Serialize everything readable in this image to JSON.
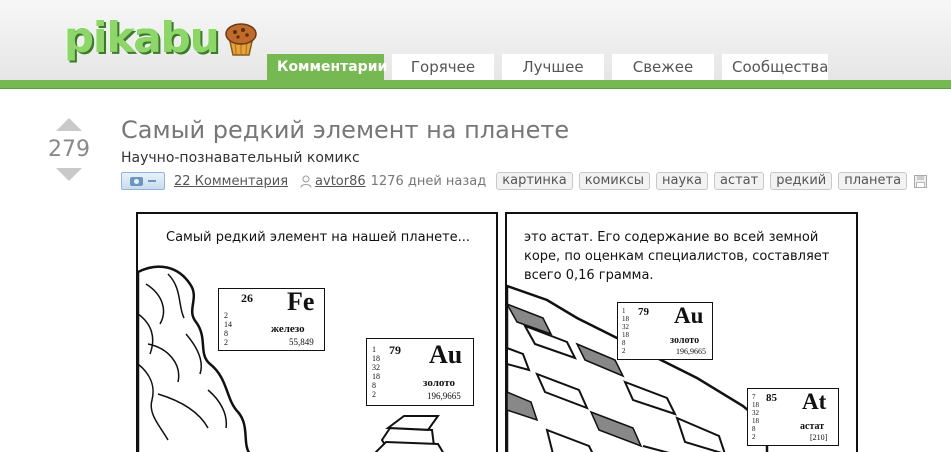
{
  "header": {
    "logo_text": "pikabu",
    "nav": [
      {
        "label": "Комментарии",
        "active": true
      },
      {
        "label": "Горячее",
        "active": false
      },
      {
        "label": "Лучшее",
        "active": false
      },
      {
        "label": "Свежее",
        "active": false
      },
      {
        "label": "Сообщества",
        "active": false
      }
    ]
  },
  "post": {
    "rating": "279",
    "title": "Самый редкий элемент на планете",
    "description": "Научно-познавательный комикс",
    "media_toggle": "–",
    "comments_link": "22 Комментария",
    "author": "avtor86",
    "age": "1276 дней назад",
    "tags": [
      "картинка",
      "комиксы",
      "наука",
      "астат",
      "редкий",
      "планета"
    ]
  },
  "comic": {
    "panel1": {
      "caption": "Самый редкий элемент на нашей планете...",
      "fe": {
        "number": "26",
        "symbol": "Fe",
        "name": "железо",
        "mass": "55,849",
        "shells": [
          "2",
          "14",
          "8",
          "2"
        ]
      },
      "au": {
        "number": "79",
        "symbol": "Au",
        "name": "золото",
        "mass": "196,9665",
        "shells": [
          "1",
          "18",
          "32",
          "18",
          "8",
          "2"
        ]
      }
    },
    "panel2": {
      "caption": "это астат. Его содержание во всей земной коре, по оценкам специалистов, составляет всего 0,16 грамма.",
      "au": {
        "number": "79",
        "symbol": "Au",
        "name": "золото",
        "mass": "196,9665",
        "shells": [
          "1",
          "18",
          "32",
          "18",
          "8",
          "2"
        ]
      },
      "at": {
        "number": "85",
        "symbol": "At",
        "name": "астат",
        "mass": "[210]",
        "shells": [
          "7",
          "18",
          "32",
          "18",
          "8",
          "2"
        ]
      }
    }
  },
  "colors": {
    "accent_green": "#76b852",
    "text_gray": "#777777"
  }
}
